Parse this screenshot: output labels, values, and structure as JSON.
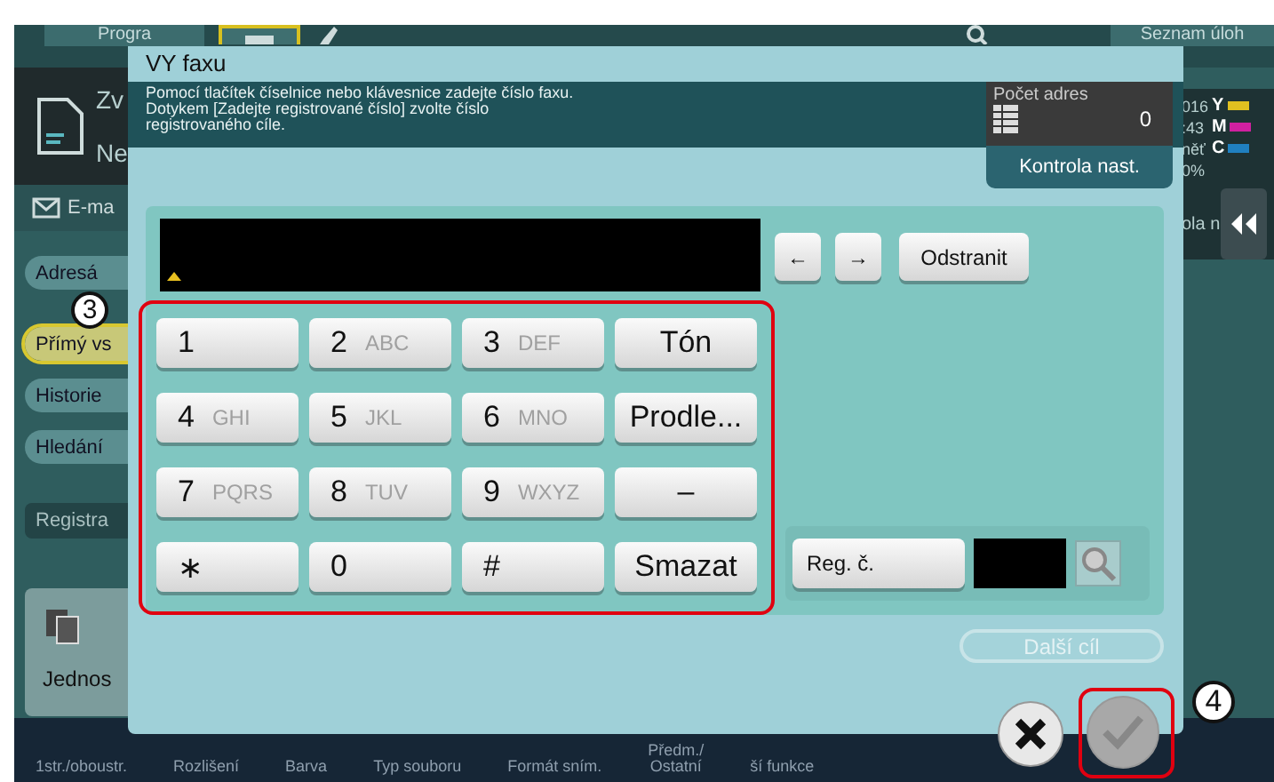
{
  "top_bar": {
    "program_tab": "Progra",
    "job_list": "Seznam úloh"
  },
  "left_panel": {
    "mode_title": "Zv",
    "mode_subtitle": "Ne",
    "email": "E-ma",
    "tabs": [
      {
        "label": "Adresá",
        "selected": false
      },
      {
        "label": "Přímý vs",
        "selected": true
      },
      {
        "label": "Historie",
        "selected": false
      },
      {
        "label": "Hledání",
        "selected": false
      }
    ],
    "register": "Registra",
    "card": "Jednos"
  },
  "status_panel": {
    "lines": [
      "016",
      ":43",
      "něť",
      "0%"
    ],
    "toners": [
      {
        "label": "Y",
        "color": "#e0c020"
      },
      {
        "label": "M",
        "color": "#d020a0"
      },
      {
        "label": "C",
        "color": "#2080c0"
      }
    ],
    "tail": "ola n"
  },
  "bottom_bar": {
    "items": [
      "1str./oboustr.",
      "Rozlišení",
      "Barva",
      "Typ souboru",
      "Formát sním.",
      "Předm./\nOstatní",
      "ší funkce"
    ]
  },
  "dialog": {
    "title": "VY faxu",
    "instructions": "Pomocí tlačítek číselnice nebo klávesnice zadejte číslo faxu. Dotykem [Zadejte registrované číslo] zvolte číslo registrovaného cíle.",
    "address_count": {
      "label": "Počet adres",
      "value": "0"
    },
    "check_settings": "Kontrola nast.",
    "cursor_left": "←",
    "cursor_right": "→",
    "delete": "Odstranit",
    "keys": [
      {
        "kind": "digit",
        "digit": "1"
      },
      {
        "kind": "digit",
        "digit": "2",
        "letters": "ABC"
      },
      {
        "kind": "digit",
        "digit": "3",
        "letters": "DEF"
      },
      {
        "kind": "function",
        "label": "Tón"
      },
      {
        "kind": "digit",
        "digit": "4",
        "letters": "GHI"
      },
      {
        "kind": "digit",
        "digit": "5",
        "letters": "JKL"
      },
      {
        "kind": "digit",
        "digit": "6",
        "letters": "MNO"
      },
      {
        "kind": "function",
        "label": "Prodle..."
      },
      {
        "kind": "digit",
        "digit": "7",
        "letters": "PQRS"
      },
      {
        "kind": "digit",
        "digit": "8",
        "letters": "TUV"
      },
      {
        "kind": "digit",
        "digit": "9",
        "letters": "WXYZ"
      },
      {
        "kind": "function",
        "label": "–"
      },
      {
        "kind": "digit",
        "digit": "∗"
      },
      {
        "kind": "digit",
        "digit": "0"
      },
      {
        "kind": "digit",
        "digit": "#"
      },
      {
        "kind": "function",
        "label": "Smazat"
      }
    ],
    "reg_button": "Reg. č.",
    "next_destination": {
      "label": "Další cíl",
      "disabled": true
    },
    "confirm": {
      "disabled": true
    }
  },
  "callouts": [
    "3",
    "4"
  ]
}
